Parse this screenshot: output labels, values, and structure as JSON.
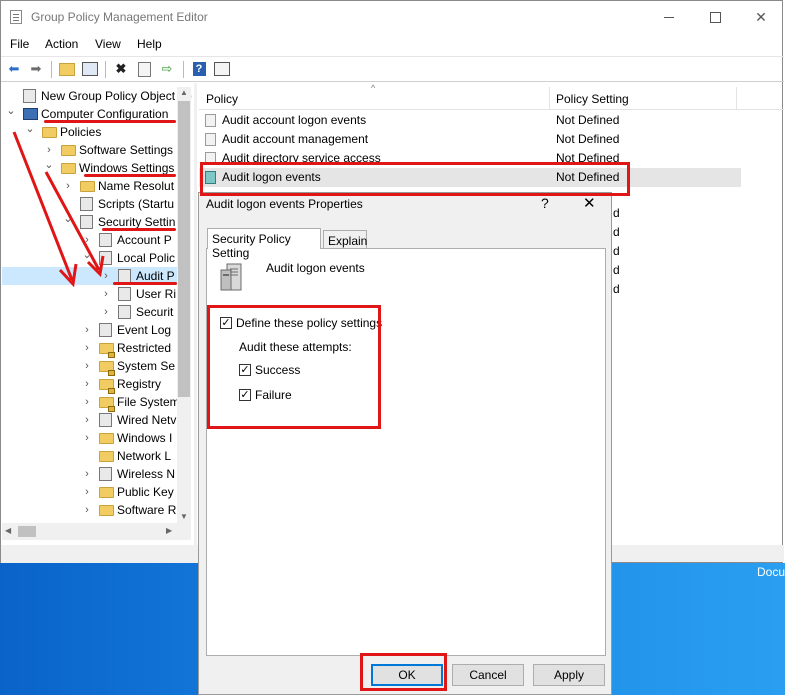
{
  "window": {
    "title": "Group Policy Management Editor"
  },
  "menu": [
    "File",
    "Action",
    "View",
    "Help"
  ],
  "tree": {
    "rows": [
      {
        "label": "New Group Policy Object Lo",
        "indent": 0,
        "chev": "",
        "icon": "doc"
      },
      {
        "label": "Computer Configuration",
        "indent": 0,
        "chev": "v",
        "icon": "comp"
      },
      {
        "label": "Policies",
        "indent": 1,
        "chev": "v",
        "icon": "folder"
      },
      {
        "label": "Software Settings",
        "indent": 2,
        "chev": ">",
        "icon": "folder"
      },
      {
        "label": "Windows Settings",
        "indent": 2,
        "chev": "v",
        "icon": "folder"
      },
      {
        "label": "Name Resolut",
        "indent": 3,
        "chev": ">",
        "icon": "folder"
      },
      {
        "label": "Scripts (Startu",
        "indent": 3,
        "chev": "",
        "icon": "doc"
      },
      {
        "label": "Security Settin",
        "indent": 3,
        "chev": "v",
        "icon": "secdoc"
      },
      {
        "label": "Account P",
        "indent": 4,
        "chev": ">",
        "icon": "secdoc"
      },
      {
        "label": "Local Polic",
        "indent": 4,
        "chev": "v",
        "icon": "secdoc"
      },
      {
        "label": "Audit P",
        "indent": 5,
        "chev": ">",
        "icon": "secdoc",
        "selected": true
      },
      {
        "label": "User Ri",
        "indent": 5,
        "chev": ">",
        "icon": "secdoc"
      },
      {
        "label": "Securit",
        "indent": 5,
        "chev": ">",
        "icon": "secdoc"
      },
      {
        "label": "Event Log",
        "indent": 4,
        "chev": ">",
        "icon": "secdoc"
      },
      {
        "label": "Restricted",
        "indent": 4,
        "chev": ">",
        "icon": "lockfolder"
      },
      {
        "label": "System Se",
        "indent": 4,
        "chev": ">",
        "icon": "lockfolder"
      },
      {
        "label": "Registry",
        "indent": 4,
        "chev": ">",
        "icon": "lockfolder"
      },
      {
        "label": "File System",
        "indent": 4,
        "chev": ">",
        "icon": "lockfolder"
      },
      {
        "label": "Wired Netv",
        "indent": 4,
        "chev": ">",
        "icon": "secdoc"
      },
      {
        "label": "Windows I",
        "indent": 4,
        "chev": ">",
        "icon": "folder"
      },
      {
        "label": "Network L",
        "indent": 4,
        "chev": "",
        "icon": "folder"
      },
      {
        "label": "Wireless N",
        "indent": 4,
        "chev": ">",
        "icon": "secdoc"
      },
      {
        "label": "Public Key",
        "indent": 4,
        "chev": ">",
        "icon": "folder"
      },
      {
        "label": "Software R",
        "indent": 4,
        "chev": ">",
        "icon": "folder"
      }
    ]
  },
  "list": {
    "headers": [
      "Policy",
      "Policy Setting"
    ],
    "rows": [
      {
        "policy": "Audit account logon events",
        "setting": "Not Defined"
      },
      {
        "policy": "Audit account management",
        "setting": "Not Defined"
      },
      {
        "policy": "Audit directory service access",
        "setting": "Not Defined"
      },
      {
        "policy": "Audit logon events",
        "setting": "Not Defined",
        "highlighted": true
      }
    ],
    "partial_settings": [
      "d",
      "d",
      "d",
      "d",
      "d"
    ]
  },
  "dialog": {
    "title": "Audit logon events Properties",
    "help": "?",
    "close": "✕",
    "tabs": [
      "Security Policy Setting",
      "Explain"
    ],
    "policy_name": "Audit logon events",
    "define_label": "Define these policy settings",
    "define_checked": true,
    "audit_heading": "Audit these attempts:",
    "success_label": "Success",
    "success_checked": true,
    "failure_label": "Failure",
    "failure_checked": true,
    "buttons": {
      "ok": "OK",
      "cancel": "Cancel",
      "apply": "Apply"
    }
  },
  "desktop_label": "Docu",
  "colors": {
    "annotation": "#e01515",
    "selection": "#cce8ff",
    "focus": "#0078d7"
  }
}
